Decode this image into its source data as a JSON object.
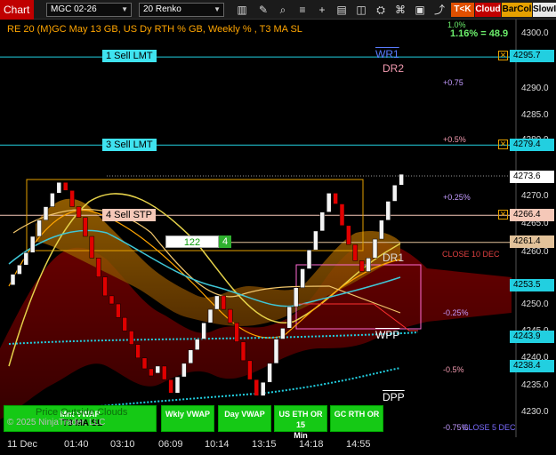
{
  "toolbar": {
    "chart_tab": "Chart",
    "instrument": "MGC 02-26",
    "bar_type": "20 Renko",
    "badges": [
      "T<K",
      "Cloud",
      "BarCol",
      "SlowIw"
    ]
  },
  "header": {
    "title": "RE 20  (M)GC May 13 GB, US Dy RTH % GB, Weekly % , T3 MA SL",
    "pct_top": "1.0%",
    "pct_summary": "1.16% = 48.9"
  },
  "price_axis": {
    "ticks": [
      "4300.0",
      "4290.0",
      "4285.0",
      "4280.0",
      "4270.0",
      "4265.0",
      "4260.0",
      "4250.0",
      "4245.0",
      "4240.0",
      "4235.0",
      "4230.0"
    ],
    "tick_values": [
      4300.0,
      4290.0,
      4285.0,
      4280.0,
      4270.0,
      4265.0,
      4260.0,
      4250.0,
      4245.0,
      4240.0,
      4235.0,
      4230.0
    ],
    "labels": [
      {
        "value": "4295.7",
        "color": "#22cfe0"
      },
      {
        "value": "4279.4",
        "color": "#22cfe0"
      },
      {
        "value": "4273.6",
        "color": "#ffffff"
      },
      {
        "value": "4266.4",
        "color": "#f5c8b8"
      },
      {
        "value": "4261.4",
        "color": "#e2c29a"
      },
      {
        "value": "4253.5",
        "color": "#22cfe0"
      },
      {
        "value": "4243.9",
        "color": "#22cfe0"
      },
      {
        "value": "4238.4",
        "color": "#22cfe0"
      }
    ]
  },
  "time_axis": [
    "11 Dec",
    "01:40",
    "03:10",
    "06:09",
    "10:14",
    "13:15",
    "14:18",
    "14:55"
  ],
  "orders": [
    {
      "label": "1 Sell LMT",
      "price": 4295.7
    },
    {
      "label": "3 Sell LMT",
      "price": 4279.4
    },
    {
      "label": "4 Sell STP",
      "price": 4266.4
    }
  ],
  "position": {
    "qty": "122",
    "count": "4"
  },
  "levels": {
    "wr1": "WR1",
    "dr2": "DR2",
    "dr1": "DR1",
    "wpp": "WPP",
    "dpp": "DPP",
    "close_10_dec": "CLOSE 10 DEC",
    "close_5_dec": "CLOSE 5 DEC"
  },
  "pct_labels": [
    "+0.75",
    "+0.5%",
    "+0.25%",
    "-0.25%",
    "-0.5%",
    "-0.75%"
  ],
  "vwap_buttons": [
    {
      "line1": "Mnt VWAP",
      "line2": ""
    },
    {
      "line1": "Wkly VWAP",
      "line2": ""
    },
    {
      "line1": "Day VWAP",
      "line2": ""
    },
    {
      "line1": "US ETH OR 15",
      "line2": "Min"
    },
    {
      "line1": "GC RTH OR",
      "line2": ""
    }
  ],
  "footer": {
    "price_outside": "Price Outside Clouds",
    "t3ma": "T3 MA SL",
    "copyright": "© 2025 NinjaTrader, LLC"
  },
  "colors": {
    "cyan": "#22cfe0",
    "orange": "#ffa500",
    "red": "#e00000",
    "green": "#15c915"
  },
  "chart_data": {
    "type": "line",
    "renko_closes": [
      4255.5,
      4257.2,
      4259.5,
      4262.5,
      4265.5,
      4268.0,
      4270.5,
      4272.5,
      4271.0,
      4268.0,
      4266.0,
      4262.5,
      4258.5,
      4255.0,
      4251.5,
      4250.0,
      4247.5,
      4245.0,
      4242.5,
      4240.0,
      4238.0,
      4237.5,
      4238.5,
      4236.0,
      4233.5,
      4236.5,
      4239.0,
      4241.5,
      4243.5,
      4246.5,
      4249.0,
      4251.5,
      4249.0,
      4246.5,
      4243.0,
      4239.5,
      4236.0,
      4233.0,
      4235.5,
      4239.0,
      4243.5,
      4245.5,
      4249.5,
      4253.0,
      4256.5,
      4260.0,
      4263.5,
      4267.0,
      4270.5,
      4268.5,
      4264.5,
      4261.0,
      4258.0,
      4256.0,
      4258.5,
      4262.0,
      4265.5,
      4269.0,
      4272.0,
      4274.0
    ]
  }
}
